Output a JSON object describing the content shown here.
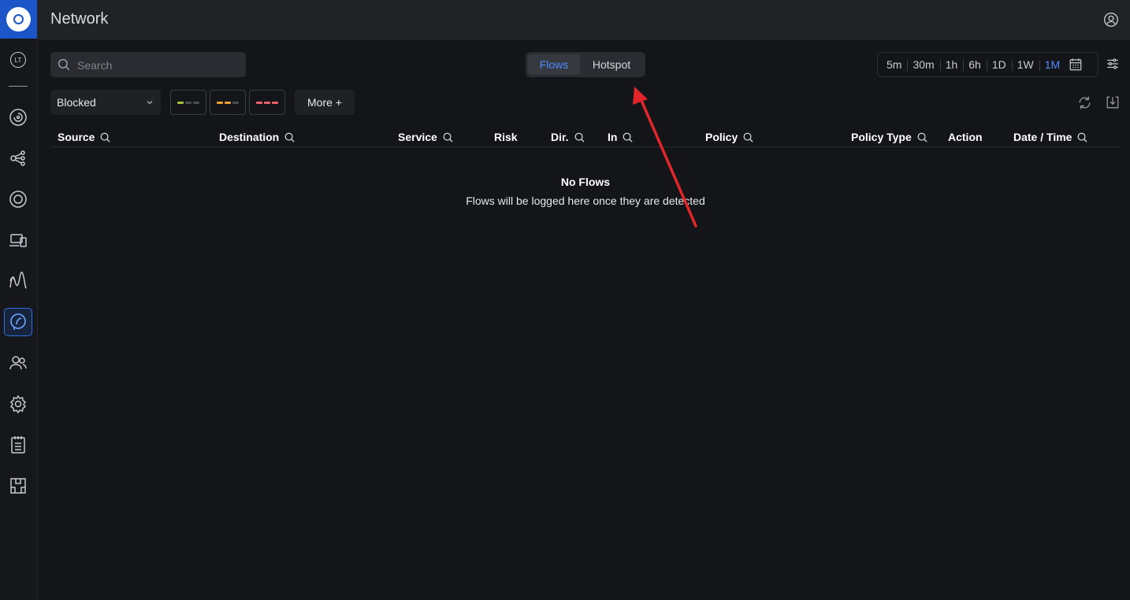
{
  "app": {
    "title": "Network"
  },
  "sidebar": {
    "items": [
      {
        "name": "lt-badge-icon",
        "label": "LT"
      },
      {
        "name": "dashboard-icon"
      },
      {
        "name": "topology-icon"
      },
      {
        "name": "unifi-devices-icon"
      },
      {
        "name": "client-devices-icon"
      },
      {
        "name": "insights-icon"
      },
      {
        "name": "flows-icon",
        "active": true
      },
      {
        "name": "clients-icon"
      },
      {
        "name": "settings-icon"
      },
      {
        "name": "logs-icon"
      },
      {
        "name": "innerspace-icon"
      }
    ]
  },
  "search": {
    "placeholder": "Search",
    "value": ""
  },
  "tabs": [
    {
      "label": "Flows",
      "active": true
    },
    {
      "label": "Hotspot",
      "active": false
    }
  ],
  "time_range": {
    "options": [
      "5m",
      "30m",
      "1h",
      "6h",
      "1D",
      "1W",
      "1M"
    ],
    "selected": "1M"
  },
  "filters": {
    "action_value": "Blocked",
    "risk_levels": [
      {
        "name": "low",
        "color": "#a8c23a"
      },
      {
        "name": "medium",
        "color": "#f0a132"
      },
      {
        "name": "high",
        "color": "#f0606a"
      }
    ],
    "more_label": "More +"
  },
  "table": {
    "columns": [
      "Source",
      "Destination",
      "Service",
      "Risk",
      "Dir.",
      "In",
      "Policy",
      "Policy Type",
      "Action",
      "Date / Time"
    ],
    "rows": []
  },
  "empty_state": {
    "title": "No Flows",
    "message": "Flows will be logged here once they are detected"
  },
  "colors": {
    "accent": "#4f8cff",
    "logo_bg": "#1b55c8",
    "annotation_arrow": "#e0262b"
  }
}
